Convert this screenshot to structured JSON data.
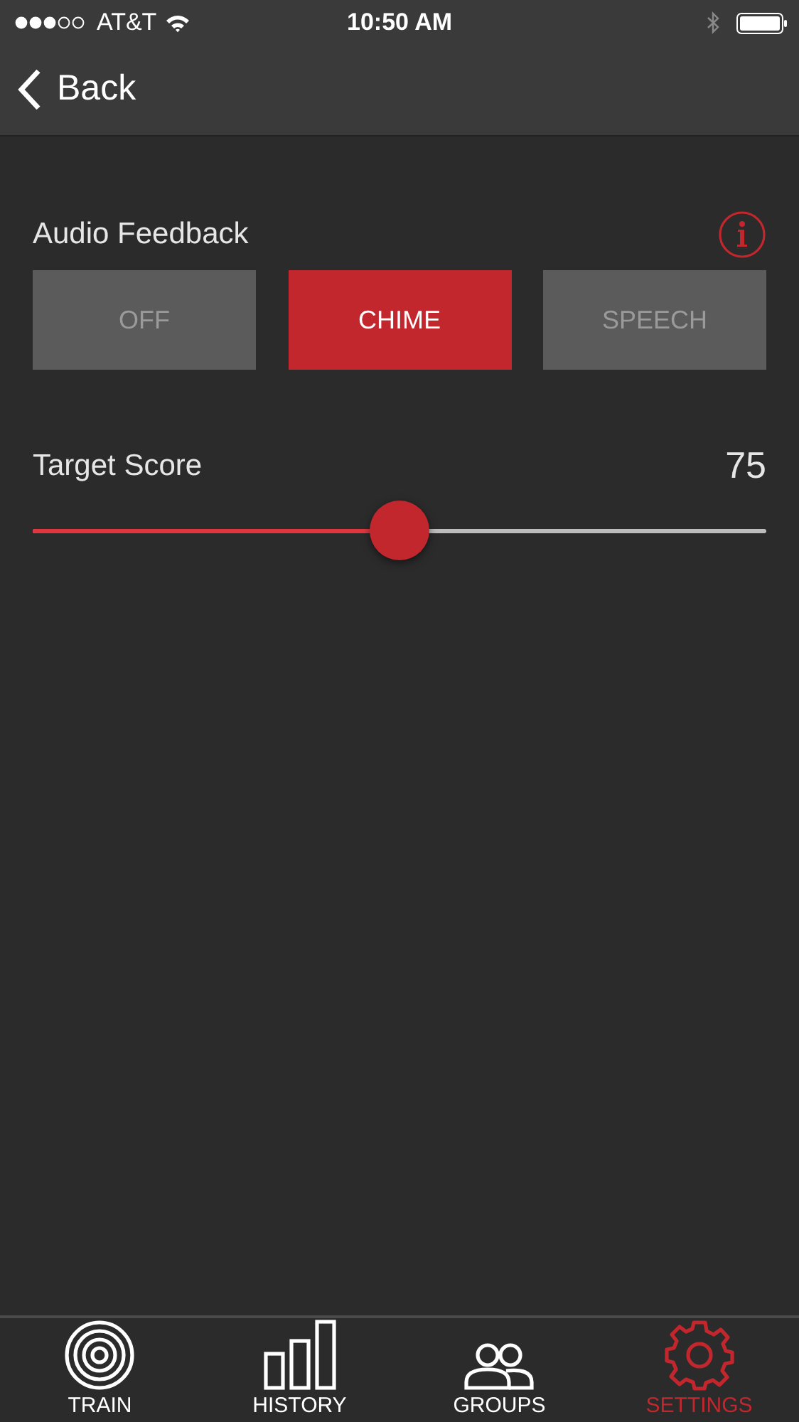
{
  "status_bar": {
    "carrier": "AT&T",
    "time": "10:50 AM"
  },
  "nav": {
    "back": "Back"
  },
  "audio_feedback": {
    "label": "Audio Feedback",
    "options": [
      {
        "label": "OFF",
        "selected": false
      },
      {
        "label": "CHIME",
        "selected": true
      },
      {
        "label": "SPEECH",
        "selected": false
      }
    ]
  },
  "target_score": {
    "label": "Target Score",
    "reading": "75",
    "level": 0.5
  },
  "tab_bar": [
    {
      "label": "TRAIN",
      "selected": false
    },
    {
      "label": "HISTORY",
      "selected": false
    },
    {
      "label": "GROUPS",
      "selected": false
    },
    {
      "label": "SETTINGS",
      "selected": true
    }
  ]
}
